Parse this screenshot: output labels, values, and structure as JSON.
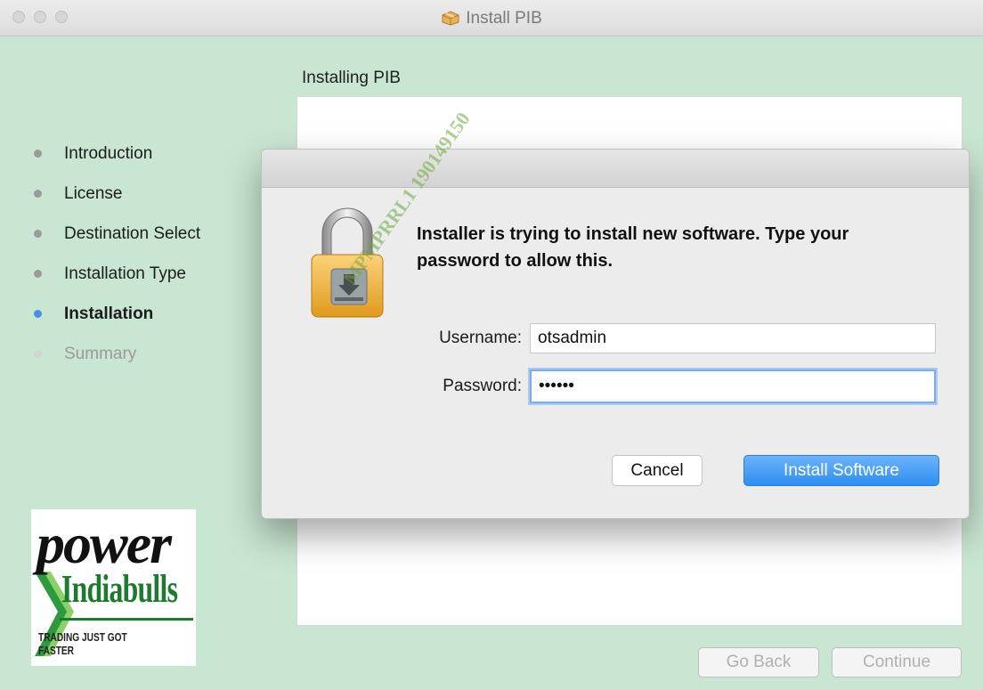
{
  "window": {
    "title": "Install PIB"
  },
  "section_title": "Installing PIB",
  "steps": [
    {
      "label": "Introduction",
      "state": "done"
    },
    {
      "label": "License",
      "state": "done"
    },
    {
      "label": "Destination Select",
      "state": "done"
    },
    {
      "label": "Installation Type",
      "state": "done"
    },
    {
      "label": "Installation",
      "state": "active"
    },
    {
      "label": "Summary",
      "state": "future"
    }
  ],
  "logo": {
    "word": "power",
    "name": "Indiabulls",
    "tagline": "TRADING JUST GOT FASTER"
  },
  "footer": {
    "back_label": "Go Back",
    "continue_label": "Continue"
  },
  "dialog": {
    "message": "Installer is trying to install new software. Type your password to allow this.",
    "username_label": "Username:",
    "username_value": "otsadmin",
    "password_label": "Password:",
    "password_value": "••••••",
    "cancel_label": "Cancel",
    "install_label": "Install Software"
  },
  "watermark": "MPMPRRL1 190149150",
  "colors": {
    "accent": "#3c96f3",
    "background": "#c9e6d2",
    "active_step": "#4a90e2"
  }
}
